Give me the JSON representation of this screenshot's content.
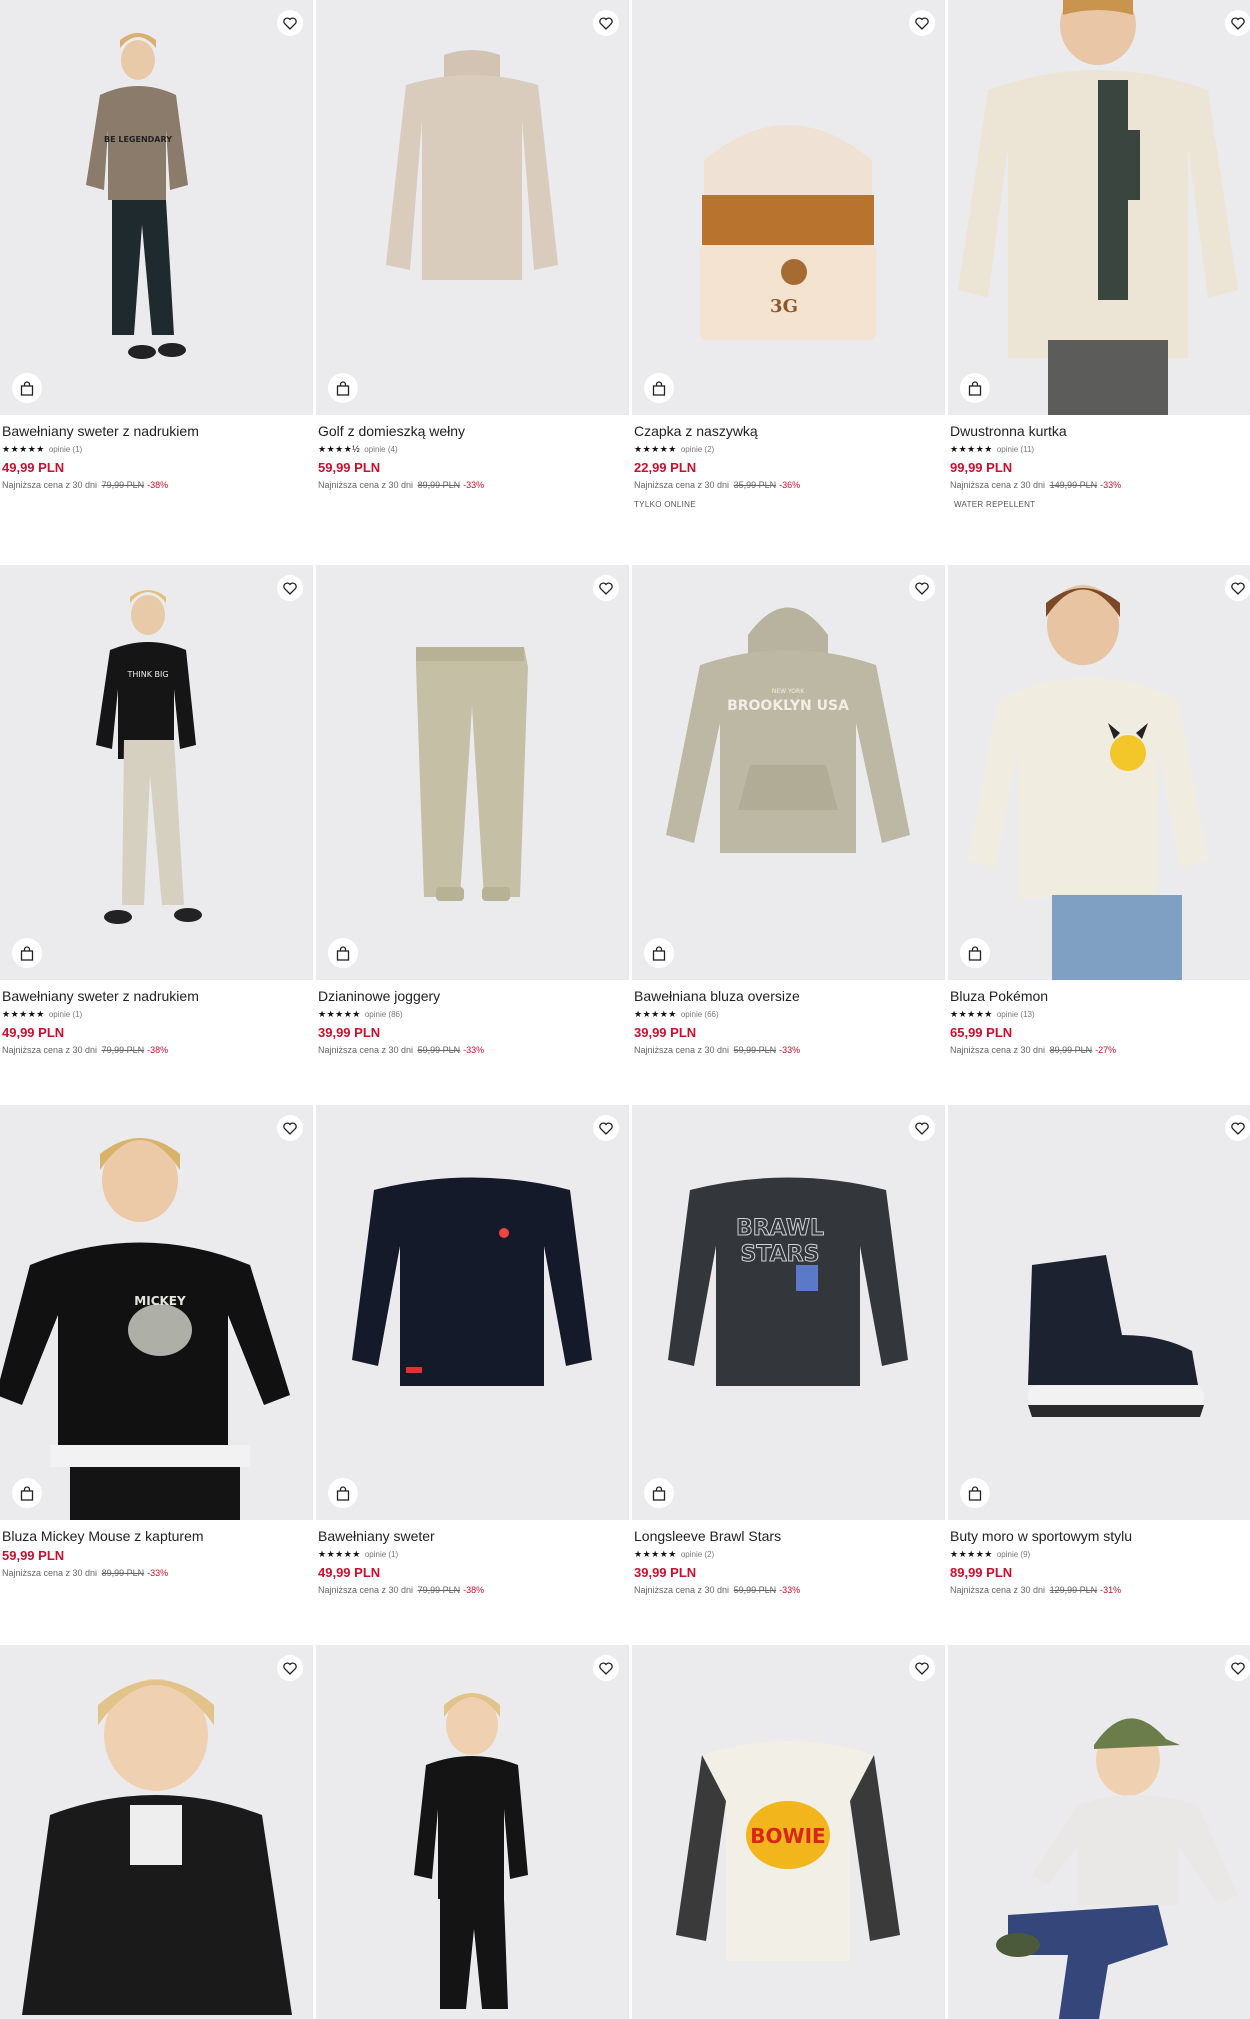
{
  "colors": {
    "price": "#c8102e",
    "image_bg": "#ebebed"
  },
  "icons": {
    "favorite": "heart-icon",
    "cart": "shopping-bag-icon"
  },
  "products": [
    {
      "name": "Bawełniany sweter z nadrukiem",
      "stars": "★★★★★",
      "reviews": "opinie (1)",
      "price": "49,99 PLN",
      "lowest_label": "Najniższa cena z 30 dni",
      "old_price": "79,99 PLN",
      "discount": "-38%",
      "tag": ""
    },
    {
      "name": "Golf z domieszką wełny",
      "stars": "★★★★½",
      "reviews": "opinie (4)",
      "price": "59,99 PLN",
      "lowest_label": "Najniższa cena z 30 dni",
      "old_price": "89,99 PLN",
      "discount": "-33%",
      "tag": ""
    },
    {
      "name": "Czapka z naszywką",
      "stars": "★★★★★",
      "reviews": "opinie (2)",
      "price": "22,99 PLN",
      "lowest_label": "Najniższa cena z 30 dni",
      "old_price": "35,99 PLN",
      "discount": "-36%",
      "tag": "TYLKO ONLINE"
    },
    {
      "name": "Dwustronna kurtka",
      "stars": "★★★★★",
      "reviews": "opinie (11)",
      "price": "99,99 PLN",
      "lowest_label": "Najniższa cena z 30 dni",
      "old_price": "149,99 PLN",
      "discount": "-33%",
      "tag": "WATER REPELLENT"
    },
    {
      "name": "Bawełniany sweter z nadrukiem",
      "stars": "★★★★★",
      "reviews": "opinie (1)",
      "price": "49,99 PLN",
      "lowest_label": "Najniższa cena z 30 dni",
      "old_price": "79,99 PLN",
      "discount": "-38%",
      "tag": ""
    },
    {
      "name": "Dzianinowe joggery",
      "stars": "★★★★★",
      "reviews": "opinie (86)",
      "price": "39,99 PLN",
      "lowest_label": "Najniższa cena z 30 dni",
      "old_price": "59,99 PLN",
      "discount": "-33%",
      "tag": ""
    },
    {
      "name": "Bawełniana bluza oversize",
      "stars": "★★★★★",
      "reviews": "opinie (66)",
      "price": "39,99 PLN",
      "lowest_label": "Najniższa cena z 30 dni",
      "old_price": "59,99 PLN",
      "discount": "-33%",
      "tag": ""
    },
    {
      "name": "Bluza Pokémon",
      "stars": "★★★★★",
      "reviews": "opinie (13)",
      "price": "65,99 PLN",
      "lowest_label": "Najniższa cena z 30 dni",
      "old_price": "89,99 PLN",
      "discount": "-27%",
      "tag": ""
    },
    {
      "name": "Bluza Mickey Mouse z kapturem",
      "stars": "",
      "reviews": "",
      "price": "59,99 PLN",
      "lowest_label": "Najniższa cena z 30 dni",
      "old_price": "89,99 PLN",
      "discount": "-33%",
      "tag": ""
    },
    {
      "name": "Bawełniany sweter",
      "stars": "★★★★★",
      "reviews": "opinie (1)",
      "price": "49,99 PLN",
      "lowest_label": "Najniższa cena z 30 dni",
      "old_price": "79,99 PLN",
      "discount": "-38%",
      "tag": ""
    },
    {
      "name": "Longsleeve Brawl Stars",
      "stars": "★★★★★",
      "reviews": "opinie (2)",
      "price": "39,99 PLN",
      "lowest_label": "Najniższa cena z 30 dni",
      "old_price": "59,99 PLN",
      "discount": "-33%",
      "tag": ""
    },
    {
      "name": "Buty moro w sportowym stylu",
      "stars": "★★★★★",
      "reviews": "opinie (9)",
      "price": "89,99 PLN",
      "lowest_label": "Najniższa cena z 30 dni",
      "old_price": "129,99 PLN",
      "discount": "-31%",
      "tag": ""
    },
    {
      "name": "",
      "stars": "",
      "reviews": "",
      "price": "",
      "lowest_label": "",
      "old_price": "",
      "discount": "",
      "tag": ""
    },
    {
      "name": "",
      "stars": "",
      "reviews": "",
      "price": "",
      "lowest_label": "",
      "old_price": "",
      "discount": "",
      "tag": ""
    },
    {
      "name": "",
      "stars": "",
      "reviews": "",
      "price": "",
      "lowest_label": "",
      "old_price": "",
      "discount": "",
      "tag": ""
    },
    {
      "name": "",
      "stars": "",
      "reviews": "",
      "price": "",
      "lowest_label": "",
      "old_price": "",
      "discount": "",
      "tag": ""
    }
  ],
  "image_texts": {
    "p0": "BE LEGENDARY",
    "p2": "3G",
    "p4": "THINK BIG",
    "p6a": "BROOKLYN USA",
    "p6b": "NEW YORK",
    "p8": "MICKEY",
    "p10a": "BRAWL",
    "p10b": "STARS",
    "p14": "BOWIE"
  }
}
